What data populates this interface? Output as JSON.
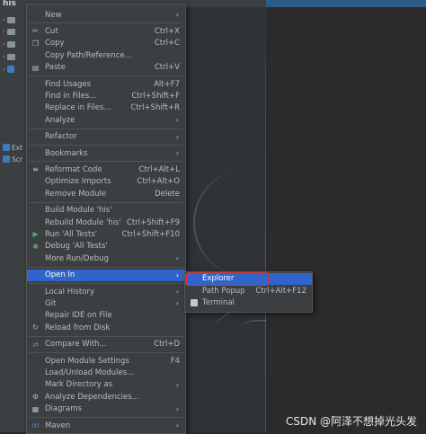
{
  "project_label": "his",
  "tree": [
    {
      "label": ""
    },
    {
      "label": ""
    },
    {
      "label": ""
    },
    {
      "label": ""
    },
    {
      "label": ""
    },
    {
      "label": "Ext"
    },
    {
      "label": "Scr"
    }
  ],
  "menu": {
    "items": [
      {
        "label": "New",
        "shortcut": "",
        "arrow": true,
        "icon": ""
      },
      {
        "sep": true
      },
      {
        "label": "Cut",
        "shortcut": "Ctrl+X",
        "icon": "✂"
      },
      {
        "label": "Copy",
        "shortcut": "Ctrl+C",
        "icon": "❐"
      },
      {
        "label": "Copy Path/Reference...",
        "shortcut": "",
        "icon": ""
      },
      {
        "label": "Paste",
        "shortcut": "Ctrl+V",
        "icon": "▤"
      },
      {
        "sep": true
      },
      {
        "label": "Find Usages",
        "shortcut": "Alt+F7",
        "icon": ""
      },
      {
        "label": "Find in Files...",
        "shortcut": "Ctrl+Shift+F",
        "icon": ""
      },
      {
        "label": "Replace in Files...",
        "shortcut": "Ctrl+Shift+R",
        "icon": ""
      },
      {
        "label": "Analyze",
        "shortcut": "",
        "arrow": true,
        "icon": ""
      },
      {
        "sep": true
      },
      {
        "label": "Refactor",
        "shortcut": "",
        "arrow": true,
        "icon": ""
      },
      {
        "sep": true
      },
      {
        "label": "Bookmarks",
        "shortcut": "",
        "arrow": true,
        "icon": ""
      },
      {
        "sep": true
      },
      {
        "label": "Reformat Code",
        "shortcut": "Ctrl+Alt+L",
        "icon": "≡"
      },
      {
        "label": "Optimize Imports",
        "shortcut": "Ctrl+Alt+O",
        "icon": ""
      },
      {
        "label": "Remove Module",
        "shortcut": "Delete",
        "icon": ""
      },
      {
        "sep": true
      },
      {
        "label": "Build Module 'his'",
        "shortcut": "",
        "icon": ""
      },
      {
        "label": "Rebuild Module 'his'",
        "shortcut": "Ctrl+Shift+F9",
        "icon": ""
      },
      {
        "label": "Run 'All Tests'",
        "shortcut": "Ctrl+Shift+F10",
        "icon": "▶",
        "icon_class": "green"
      },
      {
        "label": "Debug 'All Tests'",
        "shortcut": "",
        "icon": "✱",
        "icon_class": "green"
      },
      {
        "label": "More Run/Debug",
        "shortcut": "",
        "arrow": true,
        "icon": ""
      },
      {
        "sep": true
      },
      {
        "label": "Open In",
        "shortcut": "",
        "arrow": true,
        "icon": "",
        "selected": true
      },
      {
        "sep": true
      },
      {
        "label": "Local History",
        "shortcut": "",
        "arrow": true,
        "icon": ""
      },
      {
        "label": "Git",
        "shortcut": "",
        "arrow": true,
        "icon": ""
      },
      {
        "label": "Repair IDE on File",
        "shortcut": "",
        "icon": ""
      },
      {
        "label": "Reload from Disk",
        "shortcut": "",
        "icon": "↻"
      },
      {
        "sep": true
      },
      {
        "label": "Compare With...",
        "shortcut": "Ctrl+D",
        "icon": "⇄",
        "icon_class": "blueic"
      },
      {
        "sep": true
      },
      {
        "label": "Open Module Settings",
        "shortcut": "F4",
        "icon": ""
      },
      {
        "label": "Load/Unload Modules...",
        "shortcut": "",
        "icon": ""
      },
      {
        "label": "Mark Directory as",
        "shortcut": "",
        "arrow": true,
        "icon": ""
      },
      {
        "label": "Analyze Dependencies...",
        "shortcut": "",
        "icon": "⚙"
      },
      {
        "label": "Diagrams",
        "shortcut": "",
        "arrow": true,
        "icon": "▦"
      },
      {
        "sep": true
      },
      {
        "label": "Maven",
        "shortcut": "",
        "arrow": true,
        "icon": "m",
        "icon_class": "blueic"
      }
    ]
  },
  "submenu": {
    "items": [
      {
        "label": "Explorer",
        "shortcut": "",
        "selected": true,
        "icon": false
      },
      {
        "label": "Path Popup",
        "shortcut": "Ctrl+Alt+F12",
        "icon": false
      },
      {
        "label": "Terminal",
        "shortcut": "",
        "icon": true
      }
    ]
  },
  "watermark": "CSDN @阿泽不想掉光头发",
  "colors": {
    "selection": "#2f65ca",
    "menu_bg": "#3c3f41",
    "highlight_box": "#e0302a"
  }
}
